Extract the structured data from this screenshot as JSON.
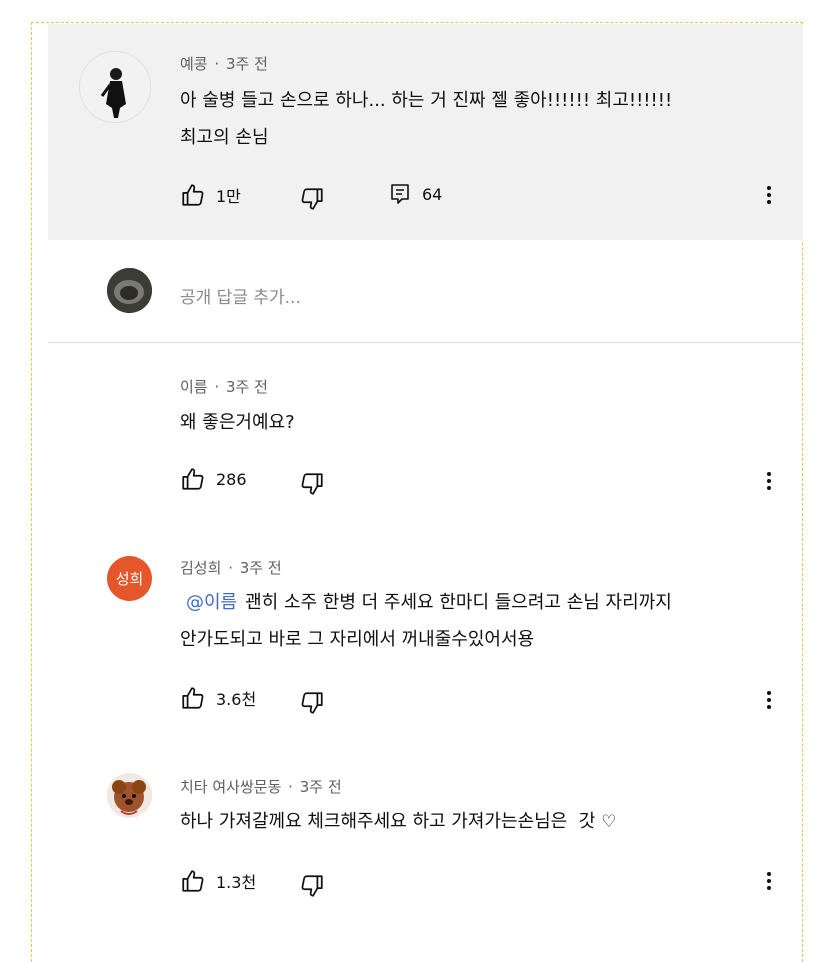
{
  "top_comment": {
    "author": "예콩",
    "time": "3주 전",
    "line1": "아 술병 들고 손으로 하나... 하는 거 진짜 젤 좋아!!!!!! 최고!!!!!!",
    "line2": "최고의 손님",
    "likes": "1만",
    "replies_count": "64"
  },
  "reply_box": {
    "placeholder": "공개 답글 추가..."
  },
  "replies": [
    {
      "author": "이름",
      "time": "3주 전",
      "text": "왜 좋은거예요?",
      "likes": "286"
    },
    {
      "author": "김성희",
      "time": "3주 전",
      "avatar_text": "성희",
      "avatar_color": "#e5572b",
      "mention": "@이름",
      "line1": "괜히 소주 한병 더 주세요 한마디 들으려고 손님 자리까지",
      "line2": "안가도되고 바로 그 자리에서 꺼내줄수있어서용",
      "likes": "3.6천"
    },
    {
      "author": "치타 여사쌍문동",
      "time": "3주 전",
      "text": "하나 가져갈께요 체크해주세요 하고 가져가는손님은  갓",
      "heart": "♡",
      "likes": "1.3천"
    }
  ],
  "meta_sep": "·"
}
